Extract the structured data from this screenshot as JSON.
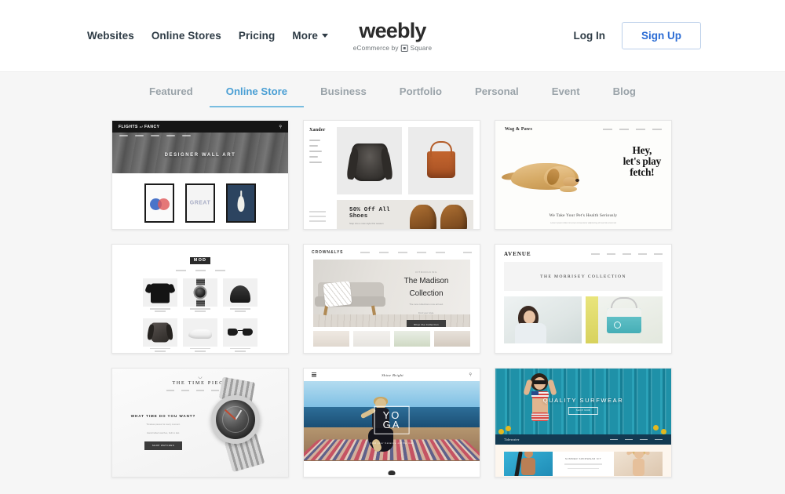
{
  "header": {
    "nav": [
      {
        "label": "Websites"
      },
      {
        "label": "Online Stores"
      },
      {
        "label": "Pricing"
      },
      {
        "label": "More"
      }
    ],
    "logo": {
      "word": "weebly",
      "tagline_before": "eCommerce by",
      "tagline_after": "Square",
      "square_icon": "square-logo-icon"
    },
    "login_label": "Log In",
    "signup_label": "Sign Up",
    "accent_color": "#2b6cd4",
    "signup_border_color": "#bcd0ea"
  },
  "tabs": {
    "active": "Online Store",
    "active_color": "#4a9fd4",
    "items": [
      {
        "label": "Featured"
      },
      {
        "label": "Online Store"
      },
      {
        "label": "Business"
      },
      {
        "label": "Portfolio"
      },
      {
        "label": "Personal"
      },
      {
        "label": "Event"
      },
      {
        "label": "Blog"
      }
    ]
  },
  "templates": [
    {
      "id": "flights-of-fancy",
      "brand": "FLIGHTS",
      "brand_italic": "of",
      "brand_tail": "FANCY",
      "hero_text": "DESIGNER WALL ART",
      "search_icon": "search-icon",
      "art_label": "GREAT"
    },
    {
      "id": "xander",
      "brand": "Xander",
      "banner_title": "50% Off All Shoes",
      "banner_sub": "Step into a new style this season"
    },
    {
      "id": "wag-and-paws",
      "brand": "Wag & Paws",
      "headline_line1": "Hey,",
      "headline_line2": "let's play",
      "headline_line3": "fetch!",
      "tagline": "We Take Your Pet's Health Seriously",
      "subtagline": "Lorem ipsum dolor sit amet consectetur adipiscing elit sed do eiusmod"
    },
    {
      "id": "mod",
      "brand": "MOD",
      "search_icon": "search-icon"
    },
    {
      "id": "crown-and-lys",
      "brand": "CROWN&LYS",
      "eyebrow": "INTRODUCING",
      "title_line1": "The Madison",
      "title_line2": "Collection",
      "desc_line1": "The new collections now arrived.",
      "desc_line2": "Find your style.",
      "cta_label": "Shop the Collection"
    },
    {
      "id": "avenue",
      "brand": "AVENUE",
      "band_title": "THE MORRISEY COLLECTION"
    },
    {
      "id": "the-time-piece",
      "brand": "THE TIME PIECE",
      "mark": "watch-mark-icon",
      "headline": "WHAT TIME DO YOU WANT?",
      "desc_line1": "Timeless pieces for every moment.",
      "desc_line2": "Handcrafted watches, built to last.",
      "cta_label": "SHOP WATCHES"
    },
    {
      "id": "yoga",
      "brand": "Shine Bright",
      "menu_icon": "hamburger-icon",
      "search_icon": "search-icon",
      "title_line1": "YO",
      "title_line2": "GA",
      "subtitle": "Find your balance on the mat"
    },
    {
      "id": "surfwear",
      "brand": "Tidewater",
      "hero_title": "QUALITY SURFWEAR",
      "cta_label": "SHOP NOW",
      "feature_title": "SUMMER SWIMWEAR KIT"
    }
  ]
}
